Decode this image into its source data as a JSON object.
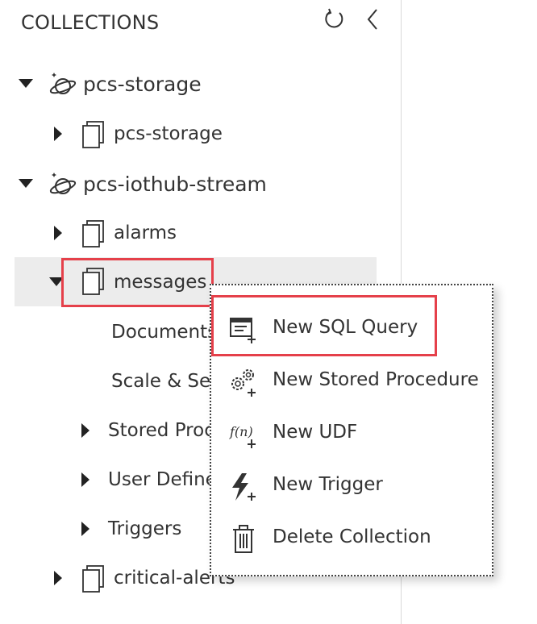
{
  "panel": {
    "title": "COLLECTIONS",
    "refresh_icon": "refresh-icon",
    "collapse_icon": "chevron-left-icon"
  },
  "tree": {
    "db1": {
      "label": "pcs-storage",
      "icon": "planet-database-icon"
    },
    "db1_coll1": {
      "label": "pcs-storage",
      "icon": "collection-document-icon"
    },
    "db2": {
      "label": "pcs-iothub-stream",
      "icon": "planet-database-icon"
    },
    "db2_alarms": {
      "label": "alarms"
    },
    "db2_messages": {
      "label": "messages"
    },
    "messages_children": {
      "documents": "Documents",
      "scale": "Scale & Se",
      "stored_procedures": "Stored Proc",
      "user_defined": "User Define",
      "triggers": "Triggers"
    },
    "db2_critical": {
      "label": "critical-alerts"
    }
  },
  "context_menu": {
    "items": [
      {
        "label": "New SQL Query",
        "icon": "new-sql-query-icon"
      },
      {
        "label": "New Stored Procedure",
        "icon": "gears-add-icon"
      },
      {
        "label": "New UDF",
        "icon": "function-add-icon"
      },
      {
        "label": "New Trigger",
        "icon": "lightning-add-icon"
      },
      {
        "label": "Delete Collection",
        "icon": "trash-icon"
      }
    ]
  },
  "colors": {
    "highlight": "#e5404a",
    "selected_row": "#ececec"
  }
}
